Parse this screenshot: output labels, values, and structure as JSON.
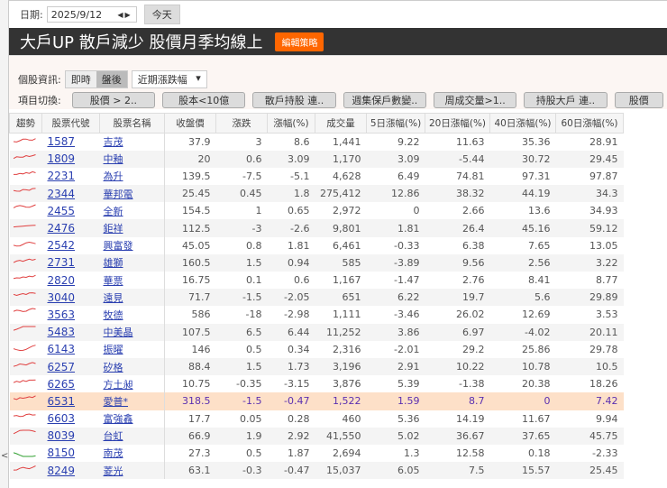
{
  "date": {
    "label": "日期:",
    "value": "2025/9/12",
    "today": "今天"
  },
  "banner": {
    "title": "大戶UP 散戶減少  股價月季均線上",
    "edit": "編輯策略"
  },
  "info": {
    "label": "個股資訊:",
    "realtime": "即時",
    "after": "盤後",
    "select": "近期漲跌幅"
  },
  "switch": {
    "label": "項目切換:",
    "items": [
      "股價 > 2..",
      "股本<10億",
      "散戶持股 連..",
      "週集保戶數變..",
      "周成交量>1..",
      "持股大戶 連..",
      "股價"
    ]
  },
  "columns": [
    "趨勢",
    "股票代號",
    "股票名稱",
    "收盤價",
    "漲跌",
    "漲幅(%)",
    "成交量",
    "5日漲幅(%)",
    "20日漲幅(%)",
    "40日漲幅(%)",
    "60日漲幅(%)"
  ],
  "rows": [
    [
      "1587",
      "吉茂",
      "37.9",
      "3",
      "8.6",
      "1,441",
      "9.22",
      "11.63",
      "35.36",
      "28.91"
    ],
    [
      "1809",
      "中釉",
      "20",
      "0.6",
      "3.09",
      "1,170",
      "3.09",
      "-5.44",
      "30.72",
      "29.45"
    ],
    [
      "2231",
      "為升",
      "139.5",
      "-7.5",
      "-5.1",
      "4,628",
      "6.49",
      "74.81",
      "97.31",
      "97.87"
    ],
    [
      "2344",
      "華邦電",
      "25.45",
      "0.45",
      "1.8",
      "275,412",
      "12.86",
      "38.32",
      "44.19",
      "34.3"
    ],
    [
      "2455",
      "全新",
      "154.5",
      "1",
      "0.65",
      "2,972",
      "0",
      "2.66",
      "13.6",
      "34.93"
    ],
    [
      "2476",
      "鉅祥",
      "112.5",
      "-3",
      "-2.6",
      "9,801",
      "1.81",
      "26.4",
      "45.16",
      "59.12"
    ],
    [
      "2542",
      "興富發",
      "45.05",
      "0.8",
      "1.81",
      "6,461",
      "-0.33",
      "6.38",
      "7.65",
      "13.05"
    ],
    [
      "2731",
      "雄獅",
      "160.5",
      "1.5",
      "0.94",
      "585",
      "-3.89",
      "9.56",
      "2.56",
      "3.22"
    ],
    [
      "2820",
      "華票",
      "16.75",
      "0.1",
      "0.6",
      "1,167",
      "-1.47",
      "2.76",
      "8.41",
      "8.77"
    ],
    [
      "3040",
      "遠見",
      "71.7",
      "-1.5",
      "-2.05",
      "651",
      "6.22",
      "19.7",
      "5.6",
      "29.89"
    ],
    [
      "3563",
      "牧德",
      "586",
      "-18",
      "-2.98",
      "1,111",
      "-3.46",
      "26.02",
      "12.69",
      "3.53"
    ],
    [
      "5483",
      "中美晶",
      "107.5",
      "6.5",
      "6.44",
      "11,252",
      "3.86",
      "6.97",
      "-4.02",
      "20.11"
    ],
    [
      "6143",
      "振曜",
      "146",
      "0.5",
      "0.34",
      "2,316",
      "-2.01",
      "29.2",
      "25.86",
      "29.78"
    ],
    [
      "6257",
      "矽格",
      "88.4",
      "1.5",
      "1.73",
      "3,196",
      "2.91",
      "10.22",
      "10.78",
      "10.5"
    ],
    [
      "6265",
      "方土昶",
      "10.75",
      "-0.35",
      "-3.15",
      "3,876",
      "5.39",
      "-1.38",
      "20.38",
      "18.26"
    ],
    [
      "6531",
      "愛普*",
      "318.5",
      "-1.5",
      "-0.47",
      "1,522",
      "1.59",
      "8.7",
      "0",
      "7.42"
    ],
    [
      "6603",
      "富強鑫",
      "17.7",
      "0.05",
      "0.28",
      "460",
      "5.36",
      "14.19",
      "11.67",
      "9.94"
    ],
    [
      "8039",
      "台虹",
      "66.9",
      "1.9",
      "2.92",
      "41,550",
      "5.02",
      "36.67",
      "37.65",
      "45.75"
    ],
    [
      "8150",
      "南茂",
      "27.3",
      "0.5",
      "1.87",
      "2,694",
      "1.3",
      "12.58",
      "0.18",
      "-2.33"
    ],
    [
      "8249",
      "菱光",
      "63.1",
      "-0.3",
      "-0.47",
      "15,037",
      "6.05",
      "7.5",
      "15.57",
      "25.45"
    ]
  ],
  "highlight_row": 15,
  "colors": {
    "accent": "#ff6600",
    "banner": "#333333",
    "up": "#e04040",
    "down": "#30a030",
    "highlight": "#fde0c8"
  }
}
